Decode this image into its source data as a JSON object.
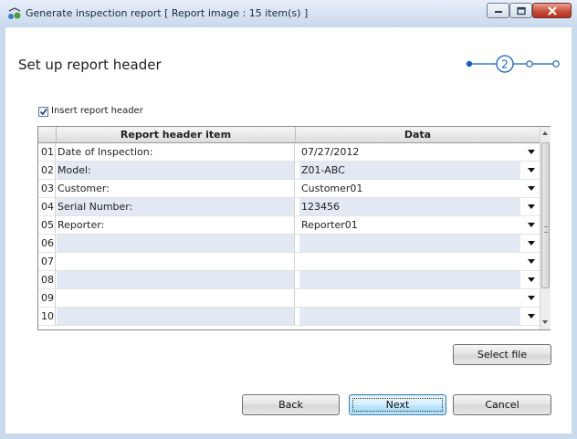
{
  "window": {
    "title": "Generate inspection report  [ Report image : 15 item(s) ]",
    "minimize_icon": "minimize-icon",
    "maximize_icon": "maximize-icon",
    "close_icon": "close-icon"
  },
  "page": {
    "heading": "Set up report header",
    "step_indicator": {
      "current_step": "2",
      "total_steps": 4
    }
  },
  "options": {
    "insert_header_label": "Insert report header",
    "insert_header_checked": true
  },
  "grid": {
    "columns": {
      "item": "Report header item",
      "data": "Data"
    },
    "rows": [
      {
        "num": "01",
        "item": "Date of Inspection:",
        "data": "07/27/2012"
      },
      {
        "num": "02",
        "item": "Model:",
        "data": "Z01-ABC"
      },
      {
        "num": "03",
        "item": "Customer:",
        "data": "Customer01"
      },
      {
        "num": "04",
        "item": "Serial Number:",
        "data": "123456"
      },
      {
        "num": "05",
        "item": "Reporter:",
        "data": "Reporter01"
      },
      {
        "num": "06",
        "item": "",
        "data": ""
      },
      {
        "num": "07",
        "item": "",
        "data": ""
      },
      {
        "num": "08",
        "item": "",
        "data": ""
      },
      {
        "num": "09",
        "item": "",
        "data": ""
      },
      {
        "num": "10",
        "item": "",
        "data": ""
      }
    ]
  },
  "buttons": {
    "select_file": "Select file",
    "back": "Back",
    "next": "Next",
    "cancel": "Cancel"
  },
  "colors": {
    "accent": "#1a5fb4",
    "row_alt": "#e3e9f3",
    "close_button": "#c8503c"
  }
}
